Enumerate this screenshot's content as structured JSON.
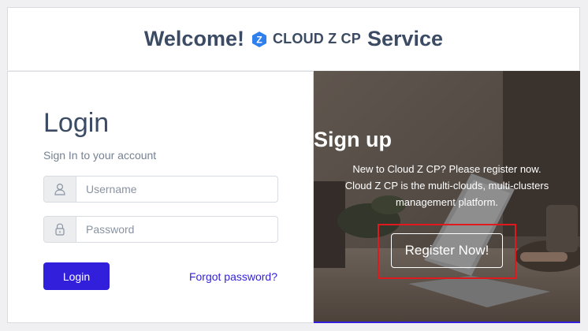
{
  "header": {
    "welcome": "Welcome!",
    "brand": "CLOUD Z CP",
    "service": "Service",
    "logo_letter": "Z"
  },
  "login": {
    "title": "Login",
    "subtitle": "Sign In to your account",
    "username_placeholder": "Username",
    "password_placeholder": "Password",
    "login_button": "Login",
    "forgot_password": "Forgot password?"
  },
  "signup": {
    "title": "Sign up",
    "line1": "New to Cloud Z CP? Please register now.",
    "line2": "Cloud Z CP is the multi-clouds, multi-clusters",
    "line3": "management platform.",
    "register_button": "Register Now!"
  },
  "colors": {
    "primary": "#321fdb",
    "heading": "#3c4b64",
    "muted": "#768192",
    "highlight": "#e0191f",
    "logo": "#2f80ed"
  },
  "icons": {
    "username": "user-icon",
    "password": "lock-icon",
    "logo": "cloud-z-logo-icon"
  }
}
